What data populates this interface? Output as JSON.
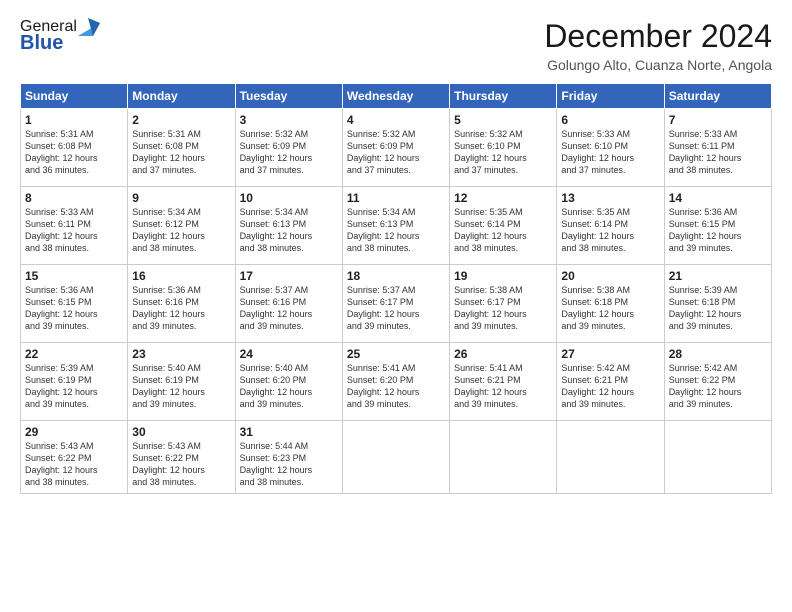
{
  "header": {
    "logo_line1": "General",
    "logo_line2": "Blue",
    "month_title": "December 2024",
    "location": "Golungo Alto, Cuanza Norte, Angola"
  },
  "weekdays": [
    "Sunday",
    "Monday",
    "Tuesday",
    "Wednesday",
    "Thursday",
    "Friday",
    "Saturday"
  ],
  "weeks": [
    [
      {
        "day": "1",
        "info": "Sunrise: 5:31 AM\nSunset: 6:08 PM\nDaylight: 12 hours\nand 36 minutes."
      },
      {
        "day": "2",
        "info": "Sunrise: 5:31 AM\nSunset: 6:08 PM\nDaylight: 12 hours\nand 37 minutes."
      },
      {
        "day": "3",
        "info": "Sunrise: 5:32 AM\nSunset: 6:09 PM\nDaylight: 12 hours\nand 37 minutes."
      },
      {
        "day": "4",
        "info": "Sunrise: 5:32 AM\nSunset: 6:09 PM\nDaylight: 12 hours\nand 37 minutes."
      },
      {
        "day": "5",
        "info": "Sunrise: 5:32 AM\nSunset: 6:10 PM\nDaylight: 12 hours\nand 37 minutes."
      },
      {
        "day": "6",
        "info": "Sunrise: 5:33 AM\nSunset: 6:10 PM\nDaylight: 12 hours\nand 37 minutes."
      },
      {
        "day": "7",
        "info": "Sunrise: 5:33 AM\nSunset: 6:11 PM\nDaylight: 12 hours\nand 38 minutes."
      }
    ],
    [
      {
        "day": "8",
        "info": "Sunrise: 5:33 AM\nSunset: 6:11 PM\nDaylight: 12 hours\nand 38 minutes."
      },
      {
        "day": "9",
        "info": "Sunrise: 5:34 AM\nSunset: 6:12 PM\nDaylight: 12 hours\nand 38 minutes."
      },
      {
        "day": "10",
        "info": "Sunrise: 5:34 AM\nSunset: 6:13 PM\nDaylight: 12 hours\nand 38 minutes."
      },
      {
        "day": "11",
        "info": "Sunrise: 5:34 AM\nSunset: 6:13 PM\nDaylight: 12 hours\nand 38 minutes."
      },
      {
        "day": "12",
        "info": "Sunrise: 5:35 AM\nSunset: 6:14 PM\nDaylight: 12 hours\nand 38 minutes."
      },
      {
        "day": "13",
        "info": "Sunrise: 5:35 AM\nSunset: 6:14 PM\nDaylight: 12 hours\nand 38 minutes."
      },
      {
        "day": "14",
        "info": "Sunrise: 5:36 AM\nSunset: 6:15 PM\nDaylight: 12 hours\nand 39 minutes."
      }
    ],
    [
      {
        "day": "15",
        "info": "Sunrise: 5:36 AM\nSunset: 6:15 PM\nDaylight: 12 hours\nand 39 minutes."
      },
      {
        "day": "16",
        "info": "Sunrise: 5:36 AM\nSunset: 6:16 PM\nDaylight: 12 hours\nand 39 minutes."
      },
      {
        "day": "17",
        "info": "Sunrise: 5:37 AM\nSunset: 6:16 PM\nDaylight: 12 hours\nand 39 minutes."
      },
      {
        "day": "18",
        "info": "Sunrise: 5:37 AM\nSunset: 6:17 PM\nDaylight: 12 hours\nand 39 minutes."
      },
      {
        "day": "19",
        "info": "Sunrise: 5:38 AM\nSunset: 6:17 PM\nDaylight: 12 hours\nand 39 minutes."
      },
      {
        "day": "20",
        "info": "Sunrise: 5:38 AM\nSunset: 6:18 PM\nDaylight: 12 hours\nand 39 minutes."
      },
      {
        "day": "21",
        "info": "Sunrise: 5:39 AM\nSunset: 6:18 PM\nDaylight: 12 hours\nand 39 minutes."
      }
    ],
    [
      {
        "day": "22",
        "info": "Sunrise: 5:39 AM\nSunset: 6:19 PM\nDaylight: 12 hours\nand 39 minutes."
      },
      {
        "day": "23",
        "info": "Sunrise: 5:40 AM\nSunset: 6:19 PM\nDaylight: 12 hours\nand 39 minutes."
      },
      {
        "day": "24",
        "info": "Sunrise: 5:40 AM\nSunset: 6:20 PM\nDaylight: 12 hours\nand 39 minutes."
      },
      {
        "day": "25",
        "info": "Sunrise: 5:41 AM\nSunset: 6:20 PM\nDaylight: 12 hours\nand 39 minutes."
      },
      {
        "day": "26",
        "info": "Sunrise: 5:41 AM\nSunset: 6:21 PM\nDaylight: 12 hours\nand 39 minutes."
      },
      {
        "day": "27",
        "info": "Sunrise: 5:42 AM\nSunset: 6:21 PM\nDaylight: 12 hours\nand 39 minutes."
      },
      {
        "day": "28",
        "info": "Sunrise: 5:42 AM\nSunset: 6:22 PM\nDaylight: 12 hours\nand 39 minutes."
      }
    ],
    [
      {
        "day": "29",
        "info": "Sunrise: 5:43 AM\nSunset: 6:22 PM\nDaylight: 12 hours\nand 38 minutes."
      },
      {
        "day": "30",
        "info": "Sunrise: 5:43 AM\nSunset: 6:22 PM\nDaylight: 12 hours\nand 38 minutes."
      },
      {
        "day": "31",
        "info": "Sunrise: 5:44 AM\nSunset: 6:23 PM\nDaylight: 12 hours\nand 38 minutes."
      },
      {
        "day": "",
        "info": ""
      },
      {
        "day": "",
        "info": ""
      },
      {
        "day": "",
        "info": ""
      },
      {
        "day": "",
        "info": ""
      }
    ]
  ]
}
